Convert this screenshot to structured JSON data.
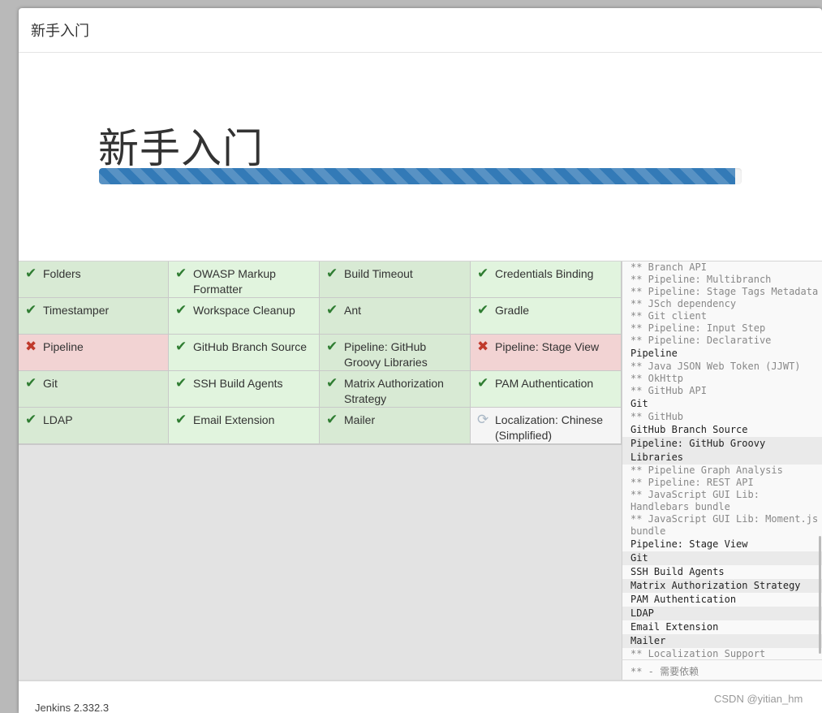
{
  "header": {
    "title": "新手入门"
  },
  "hero": {
    "title": "新手入门",
    "progress": 0.99
  },
  "plugins": [
    {
      "name": "Folders",
      "status": "ok"
    },
    {
      "name": "OWASP Markup Formatter",
      "status": "ok"
    },
    {
      "name": "Build Timeout",
      "status": "ok"
    },
    {
      "name": "Credentials Binding",
      "status": "ok"
    },
    {
      "name": "Timestamper",
      "status": "ok"
    },
    {
      "name": "Workspace Cleanup",
      "status": "ok"
    },
    {
      "name": "Ant",
      "status": "ok"
    },
    {
      "name": "Gradle",
      "status": "ok"
    },
    {
      "name": "Pipeline",
      "status": "fail"
    },
    {
      "name": "GitHub Branch Source",
      "status": "ok"
    },
    {
      "name": "Pipeline: GitHub Groovy Libraries",
      "status": "ok"
    },
    {
      "name": "Pipeline: Stage View",
      "status": "fail"
    },
    {
      "name": "Git",
      "status": "ok"
    },
    {
      "name": "SSH Build Agents",
      "status": "ok"
    },
    {
      "name": "Matrix Authorization Strategy",
      "status": "ok"
    },
    {
      "name": "PAM Authentication",
      "status": "ok"
    },
    {
      "name": "LDAP",
      "status": "ok"
    },
    {
      "name": "Email Extension",
      "status": "ok"
    },
    {
      "name": "Mailer",
      "status": "ok"
    },
    {
      "name": "Localization: Chinese (Simplified)",
      "status": "pending"
    }
  ],
  "log": [
    {
      "text": "** Branch API",
      "type": "dep"
    },
    {
      "text": "** Pipeline: Multibranch",
      "type": "dep"
    },
    {
      "text": "** Pipeline: Stage Tags Metadata",
      "type": "dep"
    },
    {
      "text": "** JSch dependency",
      "type": "dep"
    },
    {
      "text": "** Git client",
      "type": "dep"
    },
    {
      "text": "** Pipeline: Input Step",
      "type": "dep"
    },
    {
      "text": "** Pipeline: Declarative",
      "type": "dep"
    },
    {
      "text": "Pipeline",
      "type": "plugin"
    },
    {
      "text": "** Java JSON Web Token (JJWT)",
      "type": "dep"
    },
    {
      "text": "** OkHttp",
      "type": "dep"
    },
    {
      "text": "** GitHub API",
      "type": "dep"
    },
    {
      "text": "Git",
      "type": "plugin"
    },
    {
      "text": "** GitHub",
      "type": "dep"
    },
    {
      "text": "GitHub Branch Source",
      "type": "plugin"
    },
    {
      "text": "Pipeline: GitHub Groovy Libraries",
      "type": "plugin",
      "shade": true
    },
    {
      "text": "** Pipeline Graph Analysis",
      "type": "dep"
    },
    {
      "text": "** Pipeline: REST API",
      "type": "dep"
    },
    {
      "text": "** JavaScript GUI Lib: Handlebars bundle",
      "type": "dep"
    },
    {
      "text": "** JavaScript GUI Lib: Moment.js bundle",
      "type": "dep"
    },
    {
      "text": "Pipeline: Stage View",
      "type": "plugin"
    },
    {
      "text": "Git",
      "type": "plugin",
      "shade": true
    },
    {
      "text": "SSH Build Agents",
      "type": "plugin"
    },
    {
      "text": "Matrix Authorization Strategy",
      "type": "plugin",
      "shade": true
    },
    {
      "text": "PAM Authentication",
      "type": "plugin"
    },
    {
      "text": "LDAP",
      "type": "plugin",
      "shade": true
    },
    {
      "text": "Email Extension",
      "type": "plugin"
    },
    {
      "text": "Mailer",
      "type": "plugin",
      "shade": true
    },
    {
      "text": "** Localization Support",
      "type": "dep"
    }
  ],
  "legend": "** - 需要依赖",
  "footer": {
    "version": "Jenkins 2.332.3"
  },
  "watermark": "CSDN @yitian_hm",
  "icons": {
    "ok": "check-icon",
    "fail": "cross-icon",
    "pending": "refresh-icon"
  },
  "colors": {
    "progress": "#337ab7",
    "ok_bg": "#e1f4de",
    "fail_bg": "#f2d3d3"
  }
}
